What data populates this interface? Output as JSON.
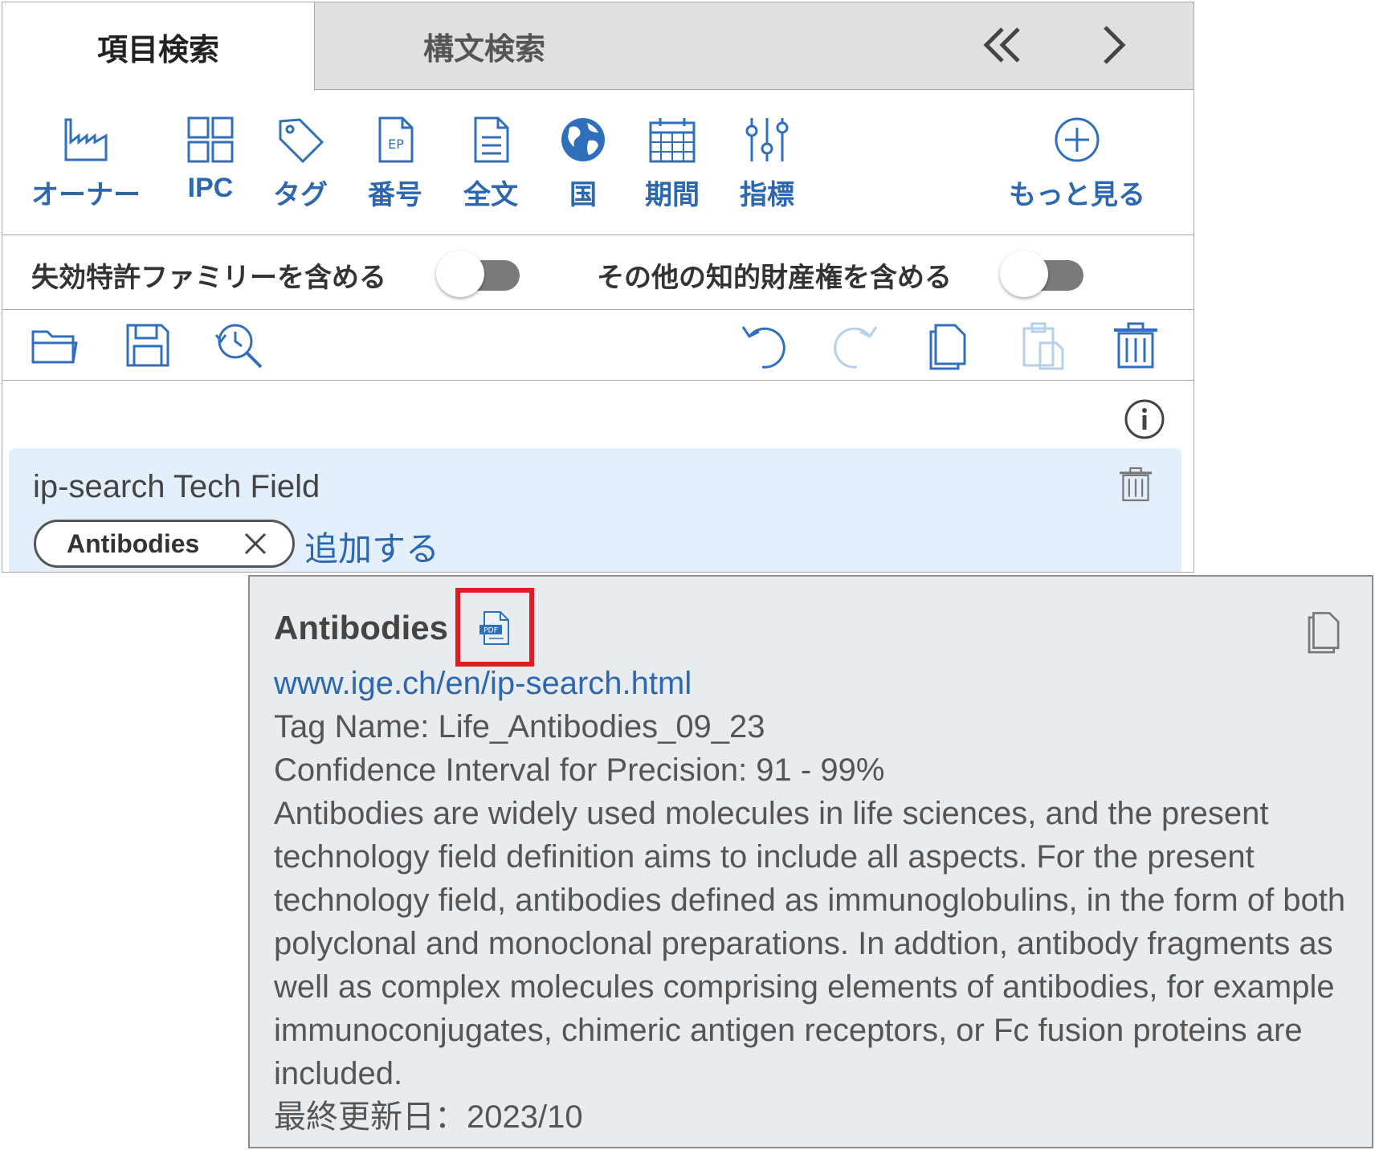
{
  "tabs": {
    "active": "項目検索",
    "inactive": "構文検索"
  },
  "toolbar": {
    "items": [
      {
        "label": "オーナー",
        "icon": "factory-icon"
      },
      {
        "label": "IPC",
        "icon": "grid-icon"
      },
      {
        "label": "タグ",
        "icon": "tag-icon"
      },
      {
        "label": "番号",
        "icon": "ep-document-icon"
      },
      {
        "label": "全文",
        "icon": "document-icon"
      },
      {
        "label": "国",
        "icon": "globe-icon"
      },
      {
        "label": "期間",
        "icon": "calendar-icon"
      },
      {
        "label": "指標",
        "icon": "sliders-icon"
      }
    ],
    "more_label": "もっと見る"
  },
  "toggles": {
    "lapsed_label": "失効特許ファミリーを含める",
    "other_ip_label": "その他の知的財産権を含める"
  },
  "field": {
    "title": "ip-search Tech Field",
    "chip": "Antibodies",
    "add_label": "追加する"
  },
  "tooltip": {
    "title": "Antibodies",
    "url": "www.ige.ch/en/ip-search.html",
    "tag_name": "Tag Name: Life_Antibodies_09_23",
    "confidence": "Confidence Interval for Precision: 91 - 99%",
    "description": "Antibodies are widely used molecules in life sciences, and the present technology field definition aims to include all aspects. For the present technology field, antibodies defined as immunoglobulins, in the form of both polyclonal and monoclonal preparations. In addtion, antibody fragments as well as complex molecules comprising elements of antibodies, for example immunoconjugates, chimeric antigen receptors, or Fc fusion proteins are included.",
    "updated": "最終更新日：2023/10"
  },
  "colors": {
    "accent": "#2c67b0",
    "highlight": "#e01b22",
    "field_bg": "#e3f0fb",
    "tooltip_bg": "#e9ecef"
  }
}
